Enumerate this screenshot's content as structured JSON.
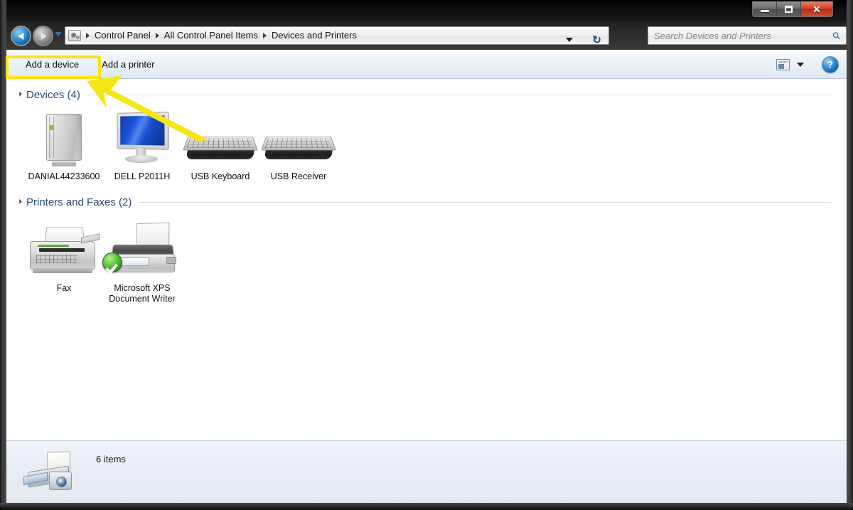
{
  "window": {
    "controls": {
      "minimize_label": "Minimize",
      "maximize_label": "Maximize",
      "close_label": "Close",
      "close_glyph": "✕"
    }
  },
  "navbar": {
    "back_label": "Back",
    "forward_label": "Forward",
    "history_label": "Recent pages",
    "breadcrumbs": [
      {
        "label": "Control Panel"
      },
      {
        "label": "All Control Panel Items"
      },
      {
        "label": "Devices and Printers"
      }
    ],
    "address_dropdown_label": "Previous locations",
    "refresh_glyph": "↻",
    "search": {
      "placeholder": "Search Devices and Printers",
      "value": "",
      "icon": "search-icon",
      "glass_glyph": "⚲"
    }
  },
  "toolbar": {
    "buttons": [
      {
        "label": "Add a device",
        "name": "add-a-device-button",
        "highlighted": true
      },
      {
        "label": "Add a printer",
        "name": "add-a-printer-button",
        "highlighted": false
      }
    ],
    "view_icon": "view-layout-icon",
    "view_dropdown": "chevron-down-icon",
    "help_label": "?",
    "help_icon": "help-icon"
  },
  "annotations": {
    "highlight_color": "#ffe11a",
    "arrow_color": "#f5e617",
    "target": "Add a device"
  },
  "content": {
    "sections": [
      {
        "title": "Devices (4)",
        "name": "devices-section",
        "items": [
          {
            "label": "DANIAL44233600",
            "icon": "computer-tower-icon",
            "name": "device-tile-computer"
          },
          {
            "label": "DELL P2011H",
            "icon": "monitor-icon",
            "name": "device-tile-monitor"
          },
          {
            "label": "USB Keyboard",
            "icon": "keyboard-icon",
            "name": "device-tile-usb-keyboard"
          },
          {
            "label": "USB Receiver",
            "icon": "keyboard-icon",
            "name": "device-tile-usb-receiver"
          }
        ]
      },
      {
        "title": "Printers and Faxes (2)",
        "name": "printers-and-faxes-section",
        "items": [
          {
            "label": "Fax",
            "icon": "fax-icon",
            "name": "printer-tile-fax"
          },
          {
            "label": "Microsoft XPS\nDocument Writer",
            "label_line1": "Microsoft XPS",
            "label_line2": "Document Writer",
            "icon": "printer-icon",
            "badge": "default-printer-check-icon",
            "name": "printer-tile-xps"
          }
        ]
      }
    ]
  },
  "statusbar": {
    "icon": "printer-camera-icon",
    "text": "6 items"
  }
}
